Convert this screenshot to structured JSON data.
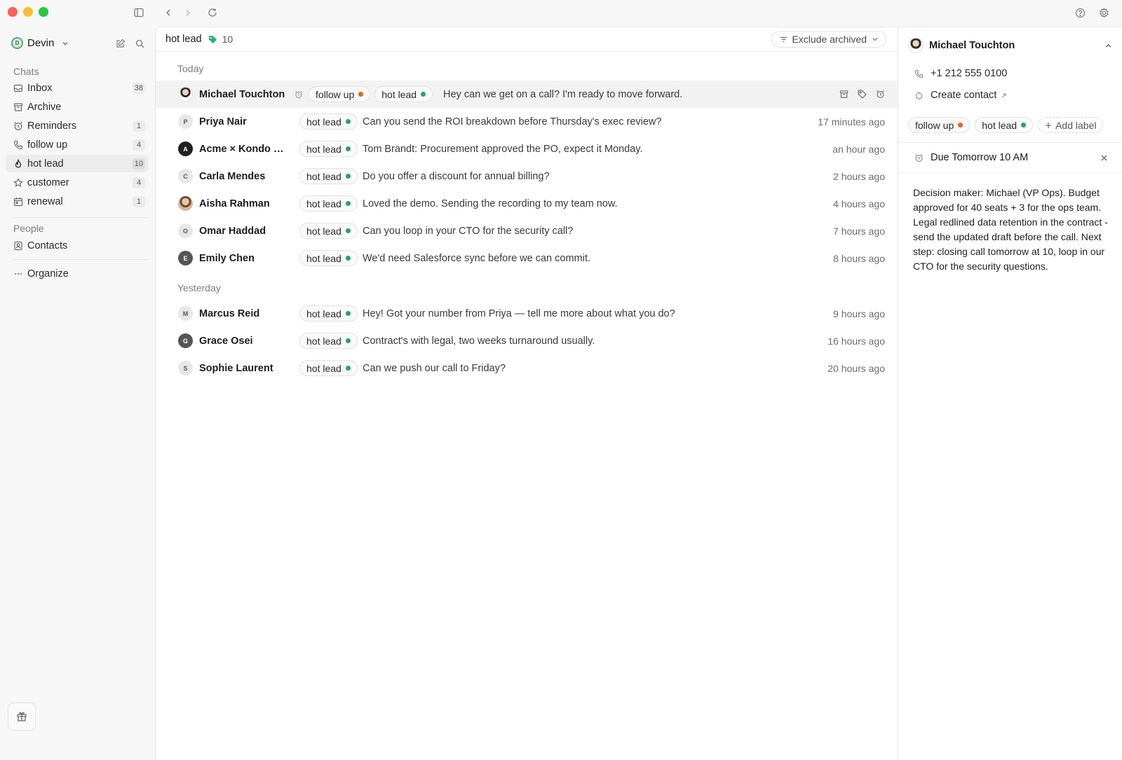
{
  "window": {
    "traffic_colors": [
      "#ff5f57",
      "#febc2e",
      "#28c840"
    ]
  },
  "sidebar": {
    "account_initial": "D",
    "account_name": "Devin",
    "chats_heading": "Chats",
    "items": [
      {
        "label": "Inbox",
        "count": "38",
        "icon": "inbox-icon"
      },
      {
        "label": "Archive",
        "count": "",
        "icon": "archive-icon"
      },
      {
        "label": "Reminders",
        "count": "1",
        "icon": "alarm-icon"
      },
      {
        "label": "follow up",
        "count": "4",
        "icon": "phone-icon"
      },
      {
        "label": "hot lead",
        "count": "10",
        "icon": "flame-icon"
      },
      {
        "label": "customer",
        "count": "4",
        "icon": "star-icon"
      },
      {
        "label": "renewal",
        "count": "1",
        "icon": "calendar-icon"
      }
    ],
    "people_heading": "People",
    "contacts_label": "Contacts",
    "organize_label": "Organize"
  },
  "main": {
    "title": "hot lead",
    "count": "10",
    "filter_label": "Exclude archived",
    "groups": {
      "today": "Today",
      "yesterday": "Yesterday"
    },
    "rows": [
      {
        "initial": "",
        "name": "Michael Touchton",
        "labels": [
          "follow up",
          "hot lead"
        ],
        "message": "Hey can we get on a call? I'm ready to move forward.",
        "time": ""
      },
      {
        "initial": "P",
        "name": "Priya Nair",
        "labels": [
          "hot lead"
        ],
        "message": "Can you send the ROI breakdown before Thursday's exec review?",
        "time": "17 minutes ago"
      },
      {
        "initial": "A",
        "name": "Acme × Kondo — d...",
        "labels": [
          "hot lead"
        ],
        "message": "Tom Brandt: Procurement approved the PO, expect it Monday.",
        "time": "an hour ago"
      },
      {
        "initial": "C",
        "name": "Carla Mendes",
        "labels": [
          "hot lead"
        ],
        "message": "Do you offer a discount for annual billing?",
        "time": "2 hours ago"
      },
      {
        "initial": "",
        "name": "Aisha Rahman",
        "labels": [
          "hot lead"
        ],
        "message": "Loved the demo. Sending the recording to my team now.",
        "time": "4 hours ago"
      },
      {
        "initial": "O",
        "name": "Omar Haddad",
        "labels": [
          "hot lead"
        ],
        "message": "Can you loop in your CTO for the security call?",
        "time": "7 hours ago"
      },
      {
        "initial": "E",
        "name": "Emily Chen",
        "labels": [
          "hot lead"
        ],
        "message": "We'd need Salesforce sync before we can commit.",
        "time": "8 hours ago"
      },
      {
        "initial": "M",
        "name": "Marcus Reid",
        "labels": [
          "hot lead"
        ],
        "message": "Hey! Got your number from Priya — tell me more about what you do?",
        "time": "9 hours ago"
      },
      {
        "initial": "G",
        "name": "Grace Osei",
        "labels": [
          "hot lead"
        ],
        "message": "Contract's with legal, two weeks turnaround usually.",
        "time": "16 hours ago"
      },
      {
        "initial": "S",
        "name": "Sophie Laurent",
        "labels": [
          "hot lead"
        ],
        "message": "Can we push our call to Friday?",
        "time": "20 hours ago"
      }
    ]
  },
  "detail": {
    "name": "Michael Touchton",
    "phone": "+1 212 555 0100",
    "create_contact": "Create contact",
    "labels": [
      "follow up",
      "hot lead"
    ],
    "add_label": "Add label",
    "due": "Due Tomorrow 10 AM",
    "note": "Decision maker: Michael (VP Ops). Budget approved for 40 seats + 3 for the ops team. Legal redlined data retention in the contract - send the updated draft before the call. Next step: closing call tomorrow at 10, loop in our CTO for the security questions."
  },
  "colors": {
    "follow_up_dot": "#e8621c",
    "hot_lead_dot": "#25a560",
    "tag_icon": "#2bb06e"
  }
}
